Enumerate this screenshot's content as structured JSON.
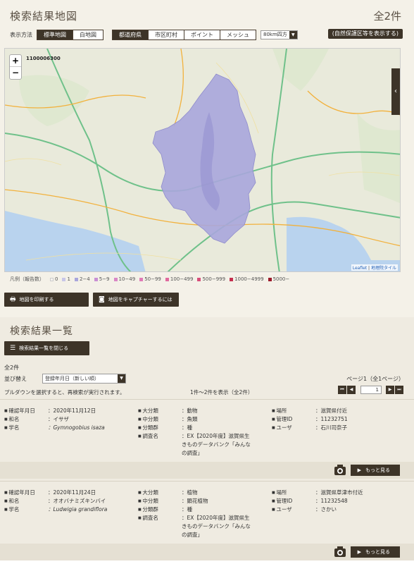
{
  "header": {
    "title": "検索結果地図",
    "total": "全2件"
  },
  "controls": {
    "display_label": "表示方法",
    "map_types": [
      "標準地図",
      "白地図"
    ],
    "area_types": [
      "都道府県",
      "市区町村",
      "ポイント",
      "メッシュ"
    ],
    "mesh_select": "80km四方",
    "nature_button": "(自然保護区等を表示する)"
  },
  "map": {
    "mesh_id": "1100006300",
    "zoom_in": "+",
    "zoom_out": "−",
    "side_toggle": "‹",
    "attribution_leaflet": "Leaflet",
    "attribution_sep": " | ",
    "attribution_tiles": "地理院タイル"
  },
  "legend": {
    "label": "凡例（報告数）",
    "items": [
      {
        "label": "0",
        "color": "#f5f2ee"
      },
      {
        "label": "1",
        "color": "#c8c6e8"
      },
      {
        "label": "2−4",
        "color": "#a9a6dc"
      },
      {
        "label": "5−9",
        "color": "#c98fd4"
      },
      {
        "label": "10−49",
        "color": "#d987c6"
      },
      {
        "label": "50−99",
        "color": "#e07ab6"
      },
      {
        "label": "100−499",
        "color": "#e06a9e"
      },
      {
        "label": "500−999",
        "color": "#d84e7a"
      },
      {
        "label": "1000−4999",
        "color": "#c52f4e"
      },
      {
        "label": "5000−",
        "color": "#9c1a2a"
      }
    ]
  },
  "buttons": {
    "print_map": "地図を印刷する",
    "capture_map": "地図をキャプチャーするには",
    "close_list": "検索結果一覧を閉じる"
  },
  "list": {
    "title": "検索結果一覧",
    "count": "全2件",
    "sort_label": "並び替え",
    "sort_value": "登録年月日（新しい順）",
    "note": "プルダウンを選択すると、再検索が実行されます。",
    "range": "1件〜2件を表示（全2件）",
    "page_info": "ページ1（全1ページ）",
    "page_input": "1",
    "more_label": "もっと見る"
  },
  "records": [
    {
      "date_key": "確認年月日",
      "date": "：2020年11月12日",
      "jname_key": "和名",
      "jname": "：イサザ",
      "sci_key": "学名",
      "sci": "：Gymnogobius isaza",
      "cat_key": "大分類",
      "cat": "：動物",
      "mid_key": "中分類",
      "mid": "：魚類",
      "group_key": "分類群",
      "group": "：種",
      "survey_key": "調査名",
      "survey": "：EX【2020年度】滋賀県生きものデータバンク「みんなの調査」",
      "place_key": "場所",
      "place": "：滋賀県付近",
      "id_key": "管理ID",
      "id": "：11232751",
      "user_key": "ユーザ",
      "user": "：石川司奈子"
    },
    {
      "date_key": "確認年月日",
      "date": "：2020年11月24日",
      "jname_key": "和名",
      "jname": "：オオバナミズキンバイ",
      "sci_key": "学名",
      "sci": "：Ludwigia grandiflora",
      "cat_key": "大分類",
      "cat": "：植物",
      "mid_key": "中分類",
      "mid": "：顕花植物",
      "group_key": "分類群",
      "group": "：種",
      "survey_key": "調査名",
      "survey": "：EX【2020年度】滋賀県生きものデータバンク「みんなの調査」",
      "place_key": "場所",
      "place": "：滋賀県草津市付近",
      "id_key": "管理ID",
      "id": "：11232548",
      "user_key": "ユーザ",
      "user": "：さかい"
    }
  ]
}
